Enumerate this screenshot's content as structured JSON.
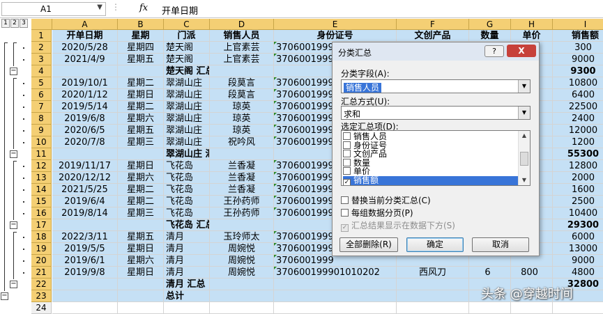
{
  "formula": {
    "cell_ref": "A1",
    "fx": "fx",
    "value": "开单日期"
  },
  "outline_levels": [
    "1",
    "2",
    "3"
  ],
  "columns": [
    "A",
    "B",
    "C",
    "D",
    "E",
    "F",
    "G",
    "H",
    "I"
  ],
  "rows": [
    {
      "num": "1",
      "cells": [
        "开单日期",
        "星期",
        "门派",
        "销售人员",
        "身份证号",
        "文创产品",
        "数量",
        "单价",
        "销售额"
      ],
      "header": true
    },
    {
      "num": "2",
      "cells": [
        "2020/5/28",
        "星期四",
        "楚天阁",
        "上官素芸",
        "3706001999",
        "",
        "",
        "",
        "300"
      ]
    },
    {
      "num": "3",
      "cells": [
        "2021/4/9",
        "星期五",
        "楚天阁",
        "上官素芸",
        "3706001999",
        "",
        "",
        "",
        "9000"
      ]
    },
    {
      "num": "4",
      "cells": [
        "",
        "",
        "楚天阁 汇总",
        "",
        "",
        "",
        "",
        "",
        "9300"
      ],
      "subtotal": true
    },
    {
      "num": "5",
      "cells": [
        "2019/10/1",
        "星期二",
        "翠湖山庄",
        "段莫言",
        "3706001999",
        "",
        "",
        "",
        "10800"
      ]
    },
    {
      "num": "6",
      "cells": [
        "2020/1/12",
        "星期日",
        "翠湖山庄",
        "段莫言",
        "3706001999",
        "",
        "",
        "",
        "6400"
      ]
    },
    {
      "num": "7",
      "cells": [
        "2019/5/14",
        "星期二",
        "翠湖山庄",
        "琼英",
        "3706001999",
        "",
        "",
        "",
        "22500"
      ]
    },
    {
      "num": "8",
      "cells": [
        "2019/6/8",
        "星期六",
        "翠湖山庄",
        "琼英",
        "3706001999",
        "",
        "",
        "",
        "2400"
      ]
    },
    {
      "num": "9",
      "cells": [
        "2020/6/5",
        "星期五",
        "翠湖山庄",
        "琼英",
        "3706001999",
        "",
        "",
        "",
        "12000"
      ]
    },
    {
      "num": "10",
      "cells": [
        "2020/7/8",
        "星期三",
        "翠湖山庄",
        "祝吟风",
        "3706001999",
        "",
        "",
        "",
        "1200"
      ]
    },
    {
      "num": "11",
      "cells": [
        "",
        "",
        "翠湖山庄 汇总",
        "",
        "",
        "",
        "",
        "",
        "55300"
      ],
      "subtotal": true
    },
    {
      "num": "12",
      "cells": [
        "2019/11/17",
        "星期日",
        "飞花岛",
        "兰香凝",
        "3706001999",
        "",
        "",
        "",
        "12800"
      ]
    },
    {
      "num": "13",
      "cells": [
        "2020/12/12",
        "星期六",
        "飞花岛",
        "兰香凝",
        "3706001999",
        "",
        "",
        "",
        "2000"
      ]
    },
    {
      "num": "14",
      "cells": [
        "2021/5/25",
        "星期二",
        "飞花岛",
        "兰香凝",
        "3706001999",
        "",
        "",
        "",
        "1600"
      ]
    },
    {
      "num": "15",
      "cells": [
        "2019/6/4",
        "星期二",
        "飞花岛",
        "王孙药师",
        "3706001999",
        "",
        "",
        "",
        "2500"
      ]
    },
    {
      "num": "16",
      "cells": [
        "2019/8/14",
        "星期三",
        "飞花岛",
        "王孙药师",
        "3706001999",
        "",
        "",
        "",
        "10400"
      ]
    },
    {
      "num": "17",
      "cells": [
        "",
        "",
        "飞花岛 汇总",
        "",
        "",
        "",
        "",
        "",
        "29300"
      ],
      "subtotal": true
    },
    {
      "num": "18",
      "cells": [
        "2022/3/11",
        "星期五",
        "清月",
        "玉玲师太",
        "3706001999",
        "",
        "",
        "",
        "6000"
      ]
    },
    {
      "num": "19",
      "cells": [
        "2019/5/5",
        "星期日",
        "清月",
        "周婉悦",
        "3706001999",
        "",
        "",
        "",
        "13000"
      ]
    },
    {
      "num": "20",
      "cells": [
        "2019/6/1",
        "星期六",
        "清月",
        "周婉悦",
        "3706001999",
        "",
        "",
        "",
        "9000"
      ]
    },
    {
      "num": "21",
      "cells": [
        "2019/9/8",
        "星期日",
        "清月",
        "周婉悦",
        "370600199901010202",
        "西风刀",
        "6",
        "800",
        "4800"
      ]
    },
    {
      "num": "22",
      "cells": [
        "",
        "",
        "清月 汇总",
        "",
        "",
        "",
        "",
        "",
        "32800"
      ],
      "subtotal": true
    },
    {
      "num": "23",
      "cells": [
        "",
        "",
        "总计",
        "",
        "",
        "",
        "",
        "",
        ""
      ],
      "subtotal": true
    },
    {
      "num": "24",
      "cells": [
        "",
        "",
        "",
        "",
        "",
        "",
        "",
        "",
        ""
      ],
      "empty": true
    }
  ],
  "dialog": {
    "title": "分类汇总",
    "help": "?",
    "close": "X",
    "group_label": "分类字段(A):",
    "group_value": "销售人员",
    "func_label": "汇总方式(U):",
    "func_value": "求和",
    "items_label": "选定汇总项(D):",
    "items": [
      {
        "label": "销售人员",
        "checked": false
      },
      {
        "label": "身份证号",
        "checked": false
      },
      {
        "label": "文创产品",
        "checked": false
      },
      {
        "label": "数量",
        "checked": false
      },
      {
        "label": "单价",
        "checked": false
      },
      {
        "label": "销售额",
        "checked": true
      }
    ],
    "replace_label": "替换当前分类汇总(C)",
    "pagebreak_label": "每组数据分页(P)",
    "below_label": "汇总结果显示在数据下方(S)",
    "remove_all": "全部删除(R)",
    "ok": "确定",
    "cancel": "取消"
  },
  "watermark": "头条 @穿越时间"
}
